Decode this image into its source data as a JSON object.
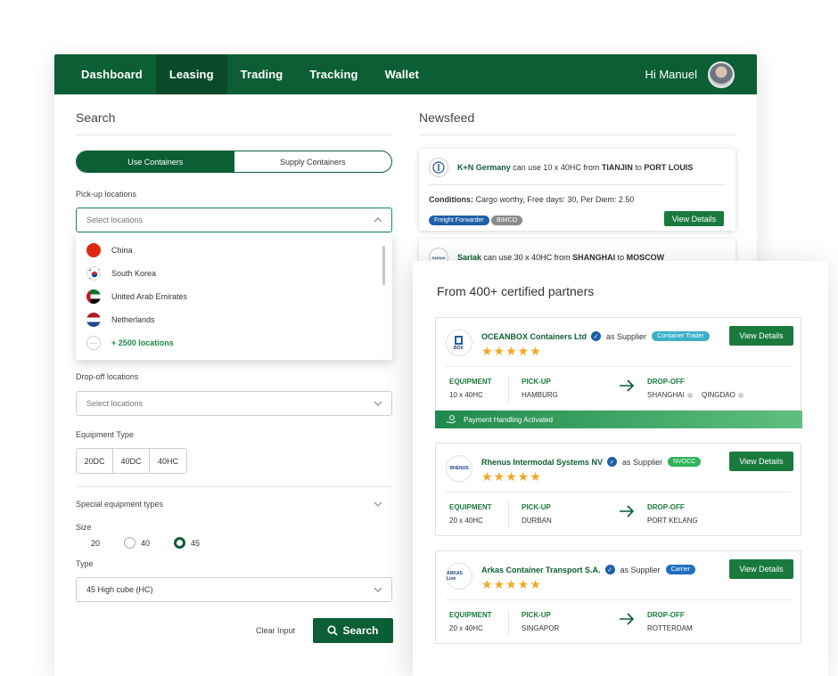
{
  "nav": {
    "items": [
      "Dashboard",
      "Leasing",
      "Trading",
      "Tracking",
      "Wallet"
    ],
    "active": "Leasing",
    "greeting": "Hi Manuel"
  },
  "search": {
    "title": "Search",
    "toggle": {
      "active": "Use Containers",
      "inactive": "Supply Containers"
    },
    "pickup_label": "Pick-up locations",
    "pickup_placeholder": "Select locations",
    "locations": [
      "China",
      "South Korea",
      "United Arab Emirates",
      "Netherlands"
    ],
    "more_locations": "+ 2500 locations",
    "more_icon": "···",
    "dropoff_label": "Drop-off locations",
    "dropoff_placeholder": "Select locations",
    "equipment_label": "Equipment Type",
    "equipment_types": [
      "20DC",
      "40DC",
      "40HC"
    ],
    "special_label": "Special equipment types",
    "size_label": "Size",
    "sizes": [
      "20",
      "40",
      "45"
    ],
    "size_selected": "45",
    "type_label": "Type",
    "type_value": "45 High cube (HC)",
    "clear_label": "Clear Input",
    "search_label": "Search"
  },
  "newsfeed": {
    "title": "Newsfeed",
    "items": [
      {
        "company": "K+N Germany",
        "text_a": "can use 10 x 40HC from",
        "from": "TIANJIN",
        "text_b": "to",
        "to": "PORT LOUIS",
        "conditions_label": "Conditions:",
        "conditions": "Cargo worthy, Free days: 30, Per Diem: 2.50",
        "tags": [
          "Freight Forwarder",
          "BIMCO"
        ],
        "button": "View Details"
      },
      {
        "company": "Sariak",
        "logo_text": "SARIAK",
        "text_a": "can use 30 x 40HC from",
        "from": "SHANGHAI",
        "text_b": "to",
        "to": "MOSCOW"
      }
    ]
  },
  "partners": {
    "title": "From 400+ certified partners",
    "cards": [
      {
        "name": "OCEANBOX Containers Ltd",
        "logo_text": "BOX",
        "role": "as Supplier",
        "tag": "Container Trader",
        "tag_color": "#3bb0c9",
        "rating": 4.5,
        "stars": "★★★★★",
        "button": "View Details",
        "equipment_label": "EQUIPMENT",
        "equipment": "10 x 40HC",
        "pickup_label": "PICK-UP",
        "pickup": "HAMBURG",
        "dropoff_label": "DROP-OFF",
        "dropoff": [
          "SHANGHAI",
          "QINGDAO"
        ],
        "payment": "Payment Handling Activated"
      },
      {
        "name": "Rhenus Intermodal Systems NV",
        "logo_text": "RHENUS",
        "role": "as Supplier",
        "tag": "NVOCC",
        "tag_color": "#2fb35a",
        "rating": 4.5,
        "stars": "★★★★★",
        "button": "View Details",
        "equipment_label": "EQUIPMENT",
        "equipment": "20 x 40HC",
        "pickup_label": "PICK-UP",
        "pickup": "DURBAN",
        "dropoff_label": "DROP-OFF",
        "dropoff": [
          "PORT KELANG"
        ]
      },
      {
        "name": "Arkas Container Transport S.A.",
        "logo_text": "ARKAS Line",
        "role": "as Supplier",
        "tag": "Carrier",
        "tag_color": "#1f6fc1",
        "rating": 5,
        "stars": "★★★★★",
        "button": "View Details",
        "equipment_label": "EQUIPMENT",
        "equipment": "20 x 40HC",
        "pickup_label": "PICK-UP",
        "pickup": "SINGAPOR",
        "dropoff_label": "DROP-OFF",
        "dropoff": [
          "ROTTERDAM"
        ]
      }
    ]
  },
  "colors": {
    "primary": "#0c5e35",
    "accent": "#1a7a3e",
    "star": "#f5a623"
  }
}
